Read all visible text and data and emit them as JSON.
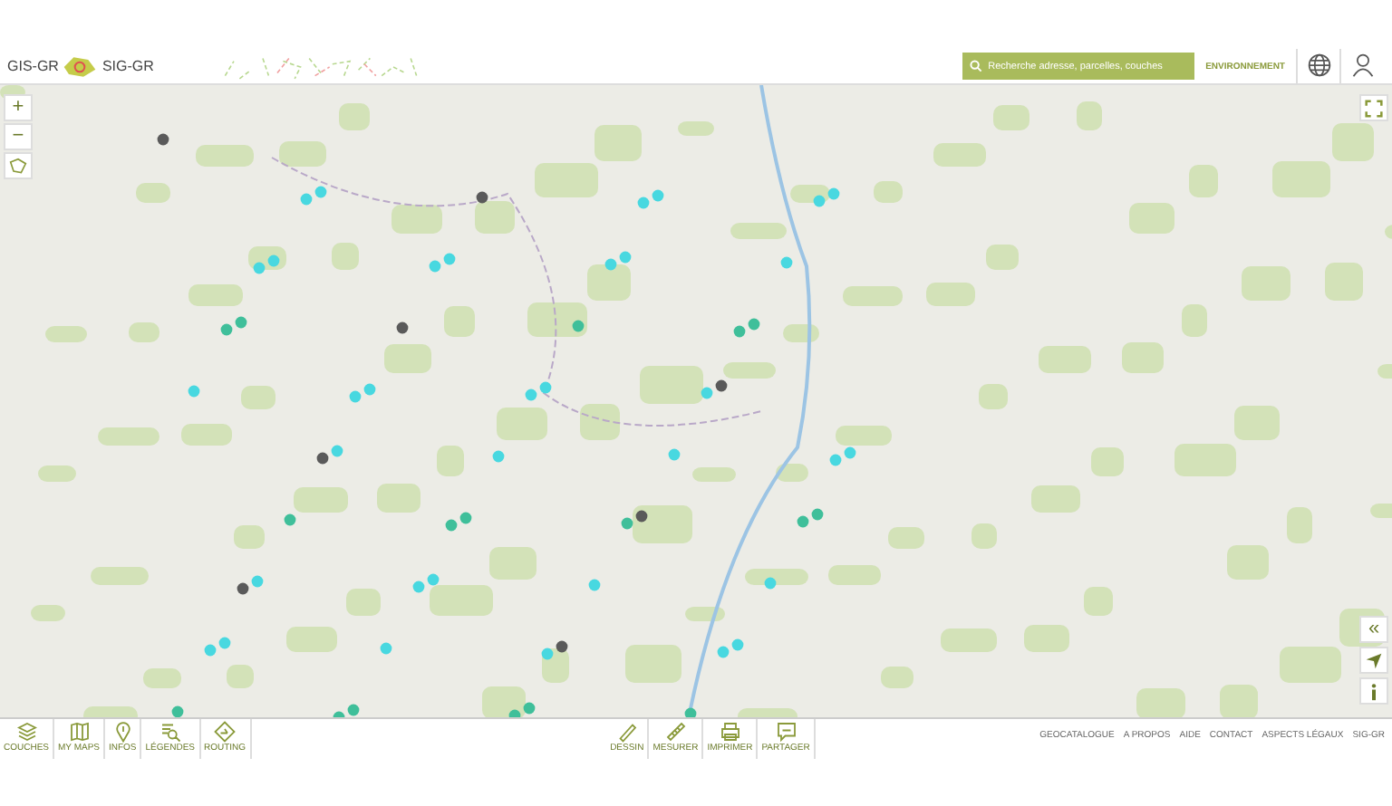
{
  "header": {
    "logo": {
      "left": "GIS-GR",
      "right": "SIG-GR"
    },
    "search": {
      "placeholder": "Recherche adresse, parcelles, couches"
    },
    "theme": "ENVIRONNEMENT"
  },
  "map_controls": {
    "zoom_in": "+",
    "zoom_out": "−",
    "collapse": "«"
  },
  "toolbar_left": [
    "COUCHES",
    "MY MAPS",
    "INFOS",
    "LÉGENDES",
    "ROUTING"
  ],
  "toolbar_right": [
    "DESSIN",
    "MESURER",
    "IMPRIMER",
    "PARTAGER"
  ],
  "footer_links": [
    "GEOCATALOGUE",
    "A PROPOS",
    "AIDE",
    "CONTACT",
    "ASPECTS LÉGAUX",
    "SIG-GR"
  ]
}
